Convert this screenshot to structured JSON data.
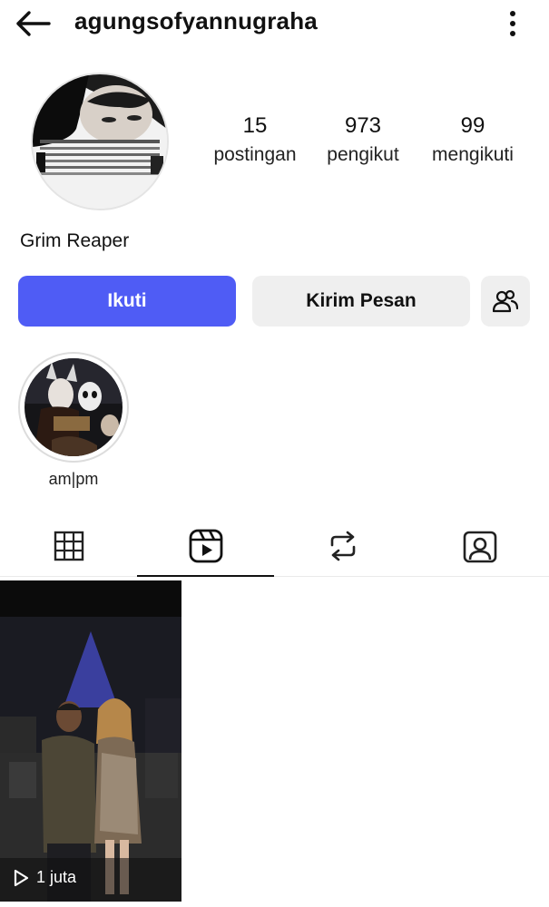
{
  "header": {
    "username": "agungsofyannugraha",
    "back_icon": "arrow-left-icon",
    "more_icon": "more-vertical-icon"
  },
  "profile": {
    "display_name": "Grim Reaper",
    "stats": [
      {
        "count": "15",
        "label": "postingan"
      },
      {
        "count": "973",
        "label": "pengikut"
      },
      {
        "count": "99",
        "label": "mengikuti"
      }
    ]
  },
  "actions": {
    "follow_label": "Ikuti",
    "message_label": "Kirim Pesan",
    "suggest_icon": "people-icon",
    "follow_color": "#4f5cf5"
  },
  "highlights": [
    {
      "label": "am|pm"
    }
  ],
  "tabs": [
    {
      "icon": "grid-icon",
      "active": false
    },
    {
      "icon": "reels-icon",
      "active": true
    },
    {
      "icon": "repost-icon",
      "active": false
    },
    {
      "icon": "tagged-icon",
      "active": false
    }
  ],
  "reels": [
    {
      "views": "1 juta",
      "play_icon": "play-icon"
    }
  ]
}
